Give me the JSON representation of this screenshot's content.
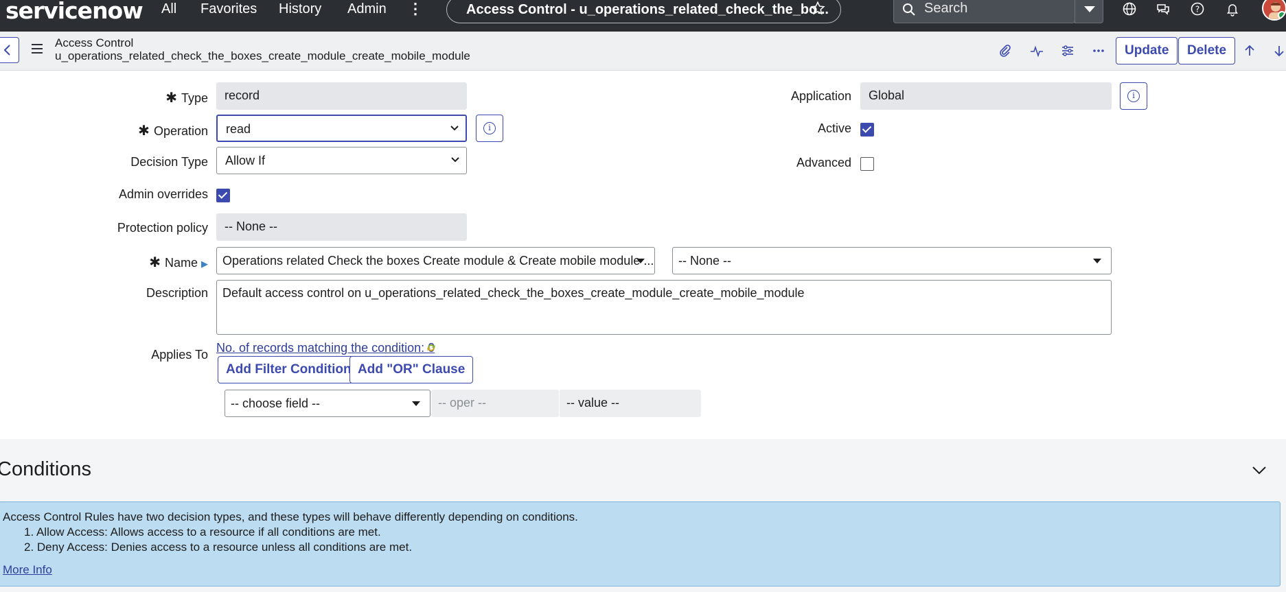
{
  "nav": {
    "logo": "servicenow",
    "links": [
      "All",
      "Favorites",
      "History",
      "Admin"
    ],
    "title": "Access Control - u_operations_related_check_the_bo...",
    "search_placeholder": "Search"
  },
  "header": {
    "line1": "Access Control",
    "line2": "u_operations_related_check_the_boxes_create_module_create_mobile_module",
    "update_label": "Update",
    "delete_label": "Delete"
  },
  "form": {
    "type_label": "Type",
    "type_value": "record",
    "operation_label": "Operation",
    "operation_value": "read",
    "decision_label": "Decision Type",
    "decision_value": "Allow If",
    "admin_overrides_label": "Admin overrides",
    "admin_overrides_checked": true,
    "protection_label": "Protection policy",
    "protection_value": "-- None --",
    "name_label": "Name",
    "name_value": "Operations related Check the boxes Create module & Create mobile module ...",
    "name_field_value": "-- None --",
    "description_label": "Description",
    "description_value": "Default access control on u_operations_related_check_the_boxes_create_module_create_mobile_module",
    "applies_to_label": "Applies To",
    "records_link": "No. of records matching the condition: 0",
    "add_filter_label": "Add Filter Condition",
    "add_or_label": "Add \"OR\" Clause",
    "choose_field": "-- choose field --",
    "oper": "-- oper --",
    "value": "-- value --",
    "application_label": "Application",
    "application_value": "Global",
    "active_label": "Active",
    "active_checked": true,
    "advanced_label": "Advanced",
    "advanced_checked": false
  },
  "conditions": {
    "title": "Conditions",
    "intro": "Access Control Rules have two decision types, and these types will behave differently depending on conditions.",
    "item1": "1. Allow Access: Allows access to a resource if all conditions are met.",
    "item2": "2. Deny Access: Denies access to a resource unless all conditions are met.",
    "more_info": "More Info"
  },
  "colors": {
    "nav_bg": "#2b2f33",
    "accent": "#3c4ab0",
    "info_bg": "#bcdcf1"
  }
}
